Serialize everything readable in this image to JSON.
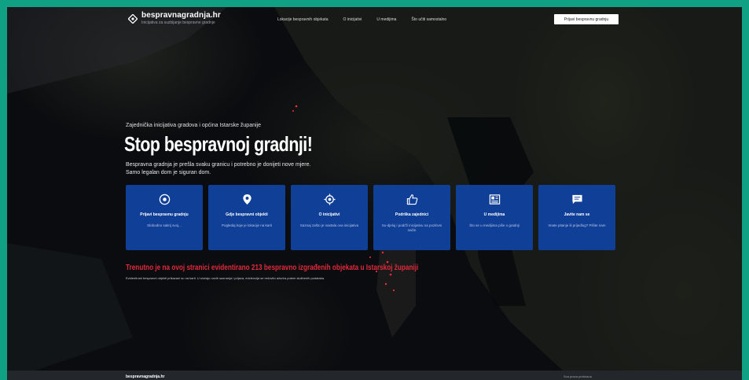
{
  "nav": {
    "logo_title": "bespravnagradnja.hr",
    "logo_subtitle": "Inicijativa za suzbijanje bespravne gradnje",
    "menu": [
      "Lokacije bespravnih objekata",
      "O inicijativi",
      "U medijima",
      "Što učiti samostalno"
    ],
    "cta_label": "Prijavi bespravnu gradnju"
  },
  "hero": {
    "kicker": "Zajednička inicijativa gradova i općina Istarske županije",
    "headline": "Stop bespravnoj gradnji!",
    "lead_line1": "Bespravna gradnja je prešla svaku granicu i potrebno je donijeti nove mjere.",
    "lead_line2": "Samo legalan dom je siguran dom."
  },
  "cards": [
    {
      "icon": "circle-dot-icon",
      "title": "Prijavi bespravnu gradnju",
      "desc": "Slobodno sakrij svoj..."
    },
    {
      "icon": "map-pin-icon",
      "title": "Gdje bespravni objekti",
      "desc": "Pogledaj koje je lokacije na karti"
    },
    {
      "icon": "target-icon",
      "title": "O inicijativi",
      "desc": "Saznaj zašto je nastala ova inicijativa"
    },
    {
      "icon": "thumbs-up-icon",
      "title": "Podrška zajednici",
      "desc": "Su-djeluj i podrži inicijativu na pozitivni način"
    },
    {
      "icon": "newspaper-icon",
      "title": "U medijima",
      "desc": "Što se u medijima piše o gradnji"
    },
    {
      "icon": "chat-icon",
      "title": "Javite nam se",
      "desc": "Imate pitanje ili prijedlog? Pišite nam"
    }
  ],
  "alert": {
    "text": "Trenutno je na ovoj stranici evidentirano 213 bespravno izgrađenih objekata u Istarskoj županiji",
    "sub": "Evidentirani bespravni objekti prikazani su na karti. U slučaju novih saznanja i prijava, evidencija se redovito ažurira putem službenih podataka."
  },
  "footer": {
    "logo": "bespravnagradnja.hr",
    "right": "Sva prava pridržana"
  },
  "colors": {
    "accent": "#103f97",
    "alert": "#e02a3a",
    "frame": "#10a083"
  }
}
